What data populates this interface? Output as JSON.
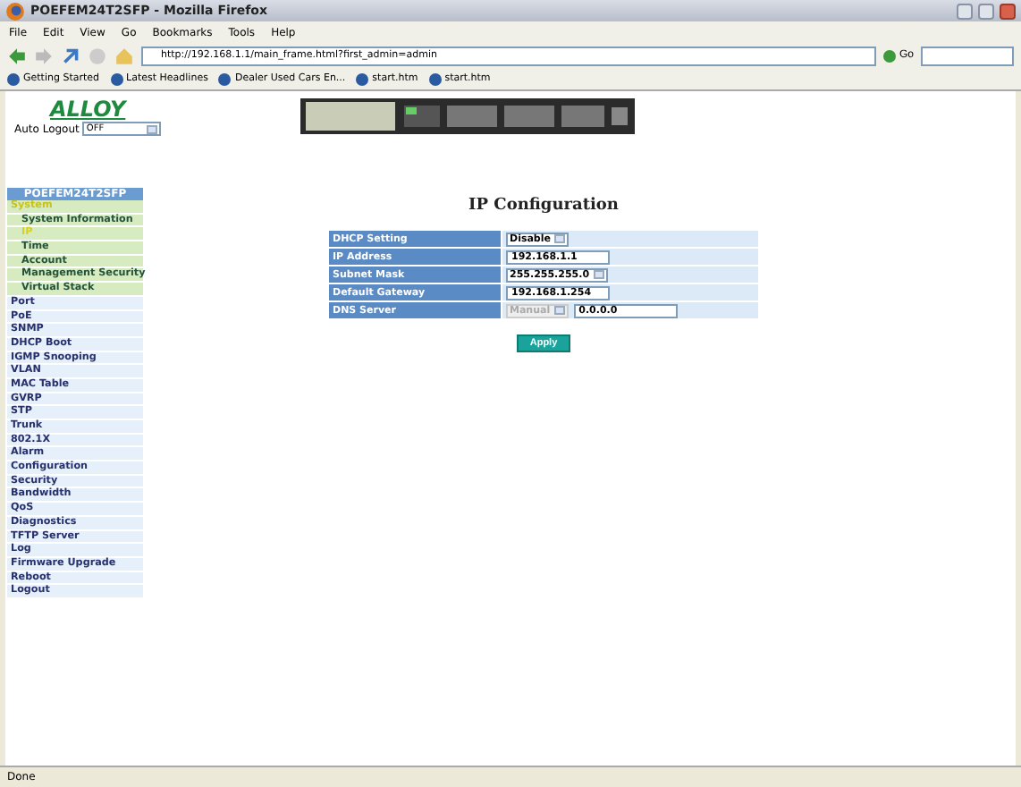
{
  "window": {
    "title": "POEFEM24T2SFP - Mozilla Firefox"
  },
  "menu": [
    "File",
    "Edit",
    "View",
    "Go",
    "Bookmarks",
    "Tools",
    "Help"
  ],
  "address_bar": {
    "url": "http://192.168.1.1/main_frame.html?first_admin=admin",
    "go": "Go"
  },
  "bookmarks": [
    {
      "label": "Getting Started"
    },
    {
      "label": "Latest Headlines"
    },
    {
      "label": "Dealer Used Cars En..."
    },
    {
      "label": "start.htm"
    },
    {
      "label": "start.htm"
    }
  ],
  "header": {
    "logo": "ALLOY",
    "auto_logout_label": "Auto Logout",
    "auto_logout_value": "OFF"
  },
  "sidebar": {
    "title": "POEFEM24T2SFP",
    "items": [
      {
        "label": "System",
        "selected": false,
        "expanded": true,
        "children": [
          {
            "label": "System Information",
            "selected": false
          },
          {
            "label": "IP",
            "selected": true
          },
          {
            "label": "Time",
            "selected": false
          },
          {
            "label": "Account",
            "selected": false
          },
          {
            "label": "Management Security",
            "selected": false
          },
          {
            "label": "Virtual Stack",
            "selected": false
          }
        ]
      },
      {
        "label": "Port",
        "selected": false
      },
      {
        "label": "PoE",
        "selected": false
      },
      {
        "label": "SNMP",
        "selected": false
      },
      {
        "label": "DHCP Boot",
        "selected": false
      },
      {
        "label": "IGMP Snooping",
        "selected": false
      },
      {
        "label": "VLAN",
        "selected": false
      },
      {
        "label": "MAC Table",
        "selected": false
      },
      {
        "label": "GVRP",
        "selected": false
      },
      {
        "label": "STP",
        "selected": false
      },
      {
        "label": "Trunk",
        "selected": false
      },
      {
        "label": "802.1X",
        "selected": false
      },
      {
        "label": "Alarm",
        "selected": false
      },
      {
        "label": "Configuration",
        "selected": false
      },
      {
        "label": "Security",
        "selected": false
      },
      {
        "label": "Bandwidth",
        "selected": false
      },
      {
        "label": "QoS",
        "selected": false
      },
      {
        "label": "Diagnostics",
        "selected": false
      },
      {
        "label": "TFTP Server",
        "selected": false
      },
      {
        "label": "Log",
        "selected": false
      },
      {
        "label": "Firmware Upgrade",
        "selected": false
      },
      {
        "label": "Reboot",
        "selected": false
      },
      {
        "label": "Logout",
        "selected": false
      }
    ]
  },
  "form": {
    "title": "IP Configuration",
    "rows": [
      {
        "label": "DHCP Setting",
        "kind": "select",
        "value": "Disable"
      },
      {
        "label": "IP Address",
        "kind": "input",
        "value": "192.168.1.1"
      },
      {
        "label": "Subnet Mask",
        "kind": "select",
        "value": "255.255.255.0"
      },
      {
        "label": "Default Gateway",
        "kind": "input",
        "value": "192.168.1.254"
      },
      {
        "label": "DNS Server",
        "kind": "select_input",
        "value": "Manual",
        "disabled": true,
        "value2": "0.0.0.0"
      }
    ],
    "apply": "Apply"
  },
  "status_bar": {
    "text": "Done"
  }
}
